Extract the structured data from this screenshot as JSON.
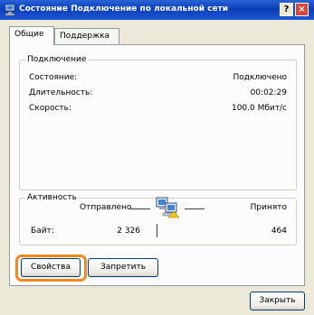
{
  "window": {
    "title": "Состояние Подключение по локальной сети",
    "help_button": "?",
    "close_button": "×"
  },
  "tabs": [
    {
      "label": "Общие",
      "active": true
    },
    {
      "label": "Поддержка",
      "active": false
    }
  ],
  "connection": {
    "legend": "Подключение",
    "status_label": "Состояние:",
    "status_value": "Подключено",
    "duration_label": "Длительность:",
    "duration_value": "00:02:29",
    "speed_label": "Скорость:",
    "speed_value": "100.0 Мбит/с"
  },
  "activity": {
    "legend": "Активность",
    "sent_label": "Отправлено",
    "received_label": "Принято",
    "bytes_label": "Байт:",
    "bytes_sent": "2 326",
    "bytes_received": "464"
  },
  "buttons": {
    "properties": "Свойства",
    "disable": "Запретить",
    "close": "Закрыть"
  },
  "icons": {
    "title_icon": "network-connection-icon",
    "activity_icon": "network-computers-icon"
  },
  "colors": {
    "titlebar": "#0a3fb8",
    "highlight": "#f08a1e"
  }
}
